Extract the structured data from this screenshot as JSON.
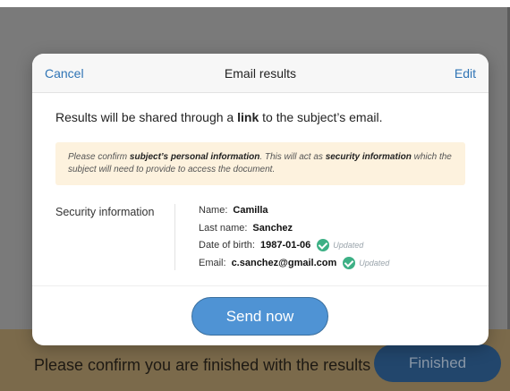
{
  "background": {
    "prompt_text": "Please confirm you are finished with the results",
    "finished_label": "Finished"
  },
  "modal": {
    "cancel_label": "Cancel",
    "title": "Email results",
    "edit_label": "Edit",
    "intro_prefix": "Results will be shared through a ",
    "intro_link": "link",
    "intro_suffix": " to the subject’s email.",
    "notice": {
      "part1": "Please confirm ",
      "bold1": "subject’s personal information",
      "part2": ". This will act as ",
      "bold2": "security information",
      "part3": " which the subject will need to provide to access the document."
    },
    "security_label": "Security information",
    "fields": {
      "name_label": "Name:",
      "name_value": "Camilla",
      "last_name_label": "Last name:",
      "last_name_value": "Sanchez",
      "dob_label": "Date of birth:",
      "dob_value": "1987-01-06",
      "dob_status": "Updated",
      "email_label": "Email:",
      "email_value": "c.sanchez@gmail.com",
      "email_status": "Updated"
    },
    "send_label": "Send now"
  },
  "colors": {
    "accent": "#2f74b5",
    "send_button": "#4f93d4",
    "notice_bg": "#fdf2de",
    "status_check": "#3db085",
    "bottom_bar": "#7b6a4b",
    "finished_button": "#22466c"
  },
  "icons": {
    "updated_status_icon": "check-circle-icon"
  }
}
